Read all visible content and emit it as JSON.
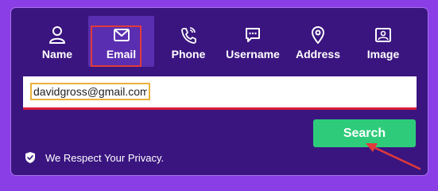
{
  "tabs": [
    {
      "label": "Name",
      "icon": "person-icon",
      "active": false
    },
    {
      "label": "Email",
      "icon": "envelope-icon",
      "active": true
    },
    {
      "label": "Phone",
      "icon": "phone-icon",
      "active": false
    },
    {
      "label": "Username",
      "icon": "chat-icon",
      "active": false
    },
    {
      "label": "Address",
      "icon": "map-pin-icon",
      "active": false
    },
    {
      "label": "Image",
      "icon": "image-icon",
      "active": false
    }
  ],
  "search": {
    "value": "davidgross@gmail.com",
    "button_label": "Search"
  },
  "privacy": {
    "text": "We Respect Your Privacy.",
    "icon": "shield-check-icon"
  },
  "colors": {
    "background": "#8a3fe6",
    "panel": "#3a1580",
    "active_tab": "#5a2eb0",
    "button": "#2ecc7a",
    "highlight_red": "#e03a3a",
    "highlight_yellow": "#e9b23c",
    "underline_red": "#d61c3a"
  }
}
